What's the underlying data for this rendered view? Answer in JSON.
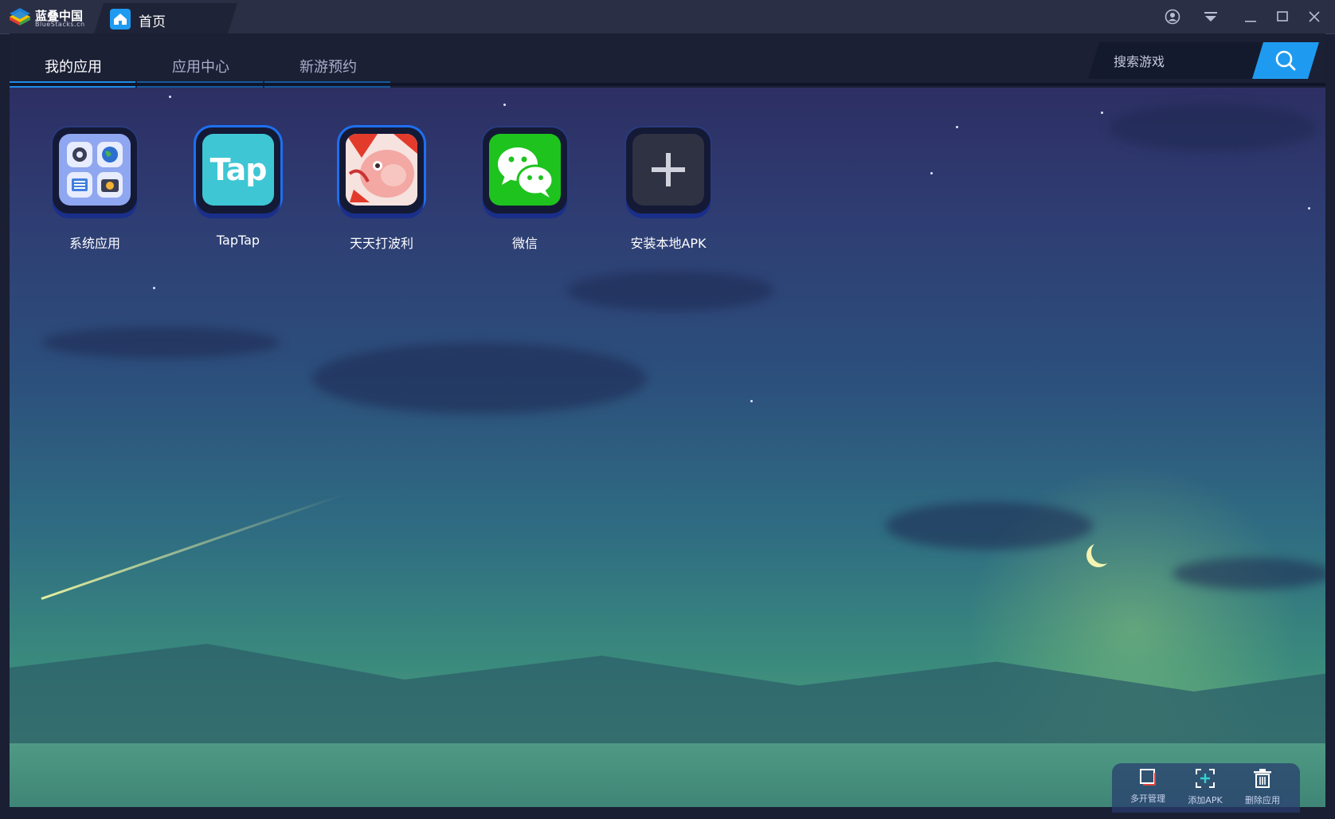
{
  "titlebar": {
    "logo_name": "蓝叠中国",
    "logo_sub": "BlueStacks.cn",
    "tab_label": "首页"
  },
  "nav": {
    "tabs": [
      {
        "label": "我的应用",
        "active": true
      },
      {
        "label": "应用中心",
        "active": false
      },
      {
        "label": "新游预约",
        "active": false
      }
    ]
  },
  "search": {
    "placeholder": "搜索游戏"
  },
  "apps": [
    {
      "label": "系统应用",
      "icon": "system-apps-icon"
    },
    {
      "label": "TapTap",
      "icon": "taptap-icon",
      "icon_text": "Tap"
    },
    {
      "label": "天天打波利",
      "icon": "tiantian-dabolii-icon"
    },
    {
      "label": "微信",
      "icon": "wechat-icon"
    },
    {
      "label": "安装本地APK",
      "icon": "plus-icon"
    }
  ],
  "toolbar": {
    "multi_instance": "多开管理",
    "add_apk": "添加APK",
    "delete_app": "删除应用"
  },
  "colors": {
    "accent": "#1e9bf0",
    "titlebar": "#2b2f45",
    "wechat_green": "#1ec31e",
    "taptap_teal": "#3ec6d4"
  }
}
